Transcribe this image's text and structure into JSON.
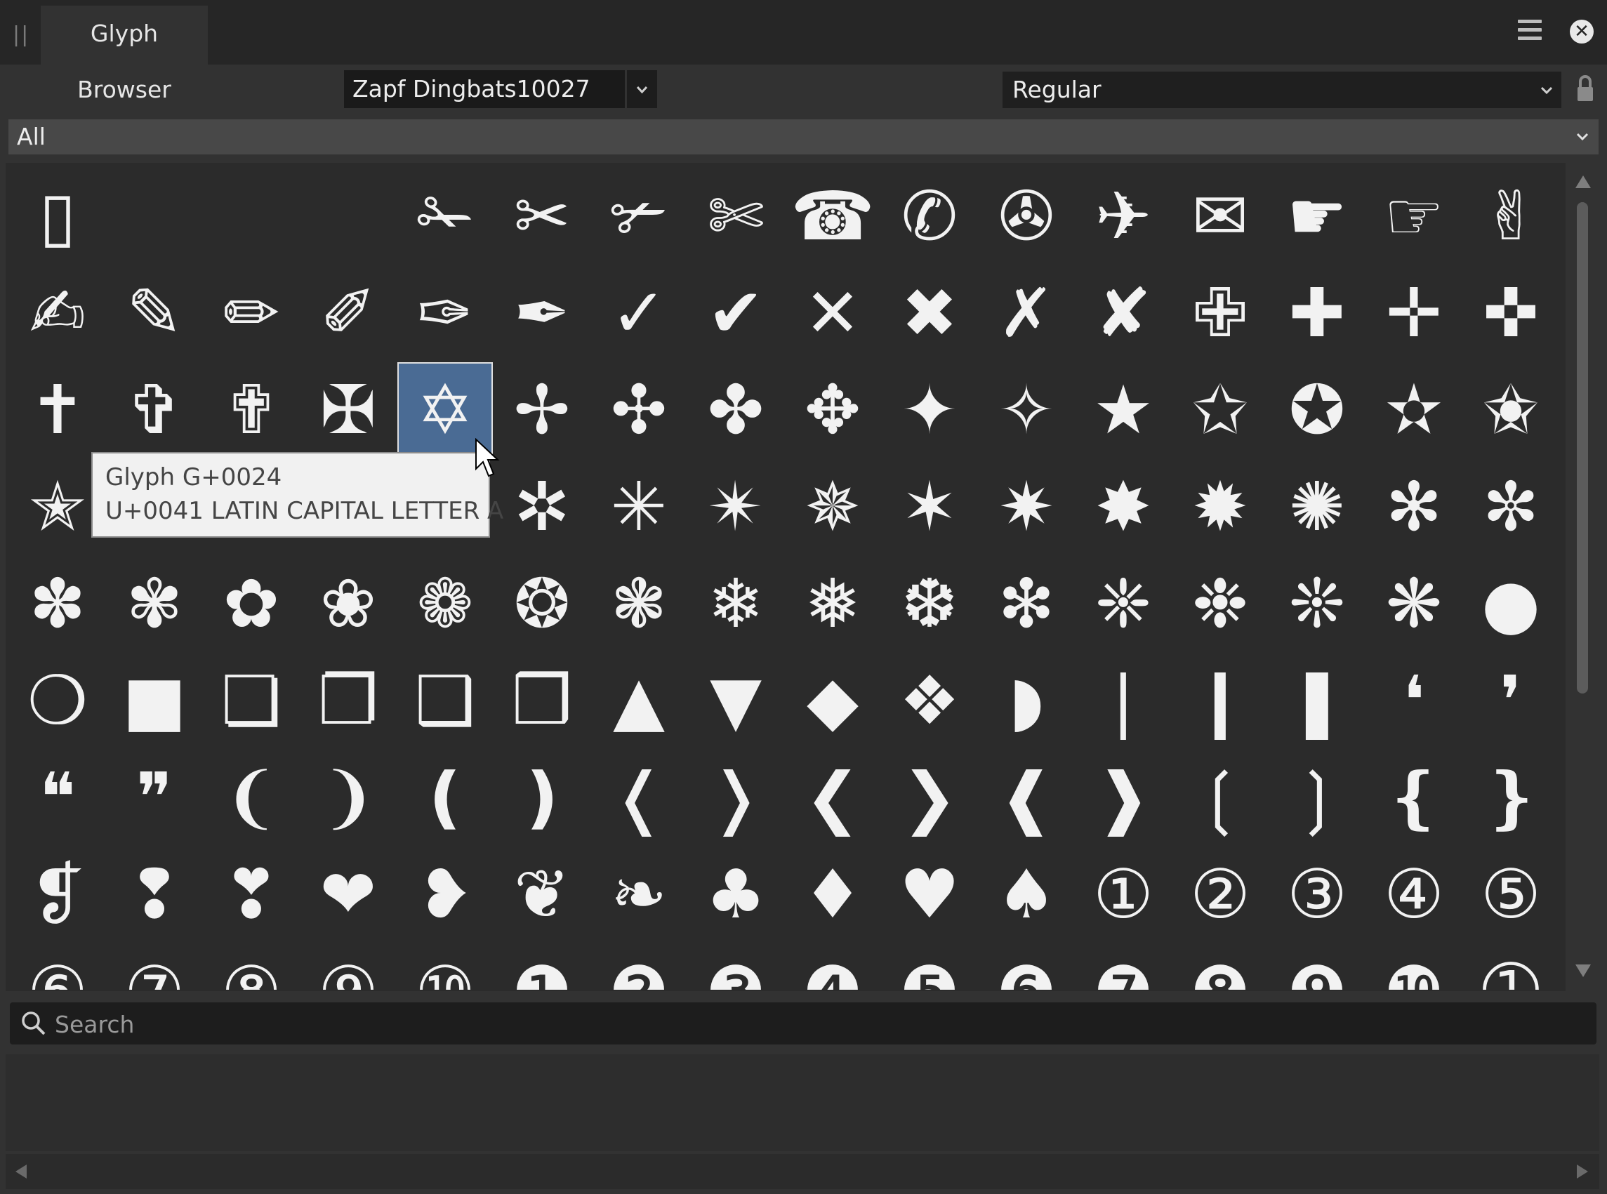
{
  "window": {
    "tab_label": "Glyph Browser",
    "menu_icon": "hamburger-menu-icon",
    "close_icon": "close-icon"
  },
  "toolbar": {
    "font_family": "Zapf Dingbats10027",
    "font_style": "Regular",
    "category": "All",
    "lock_icon": "lock-icon"
  },
  "grid": {
    "selected_index": 36,
    "cells": [
      "▯",
      "",
      "",
      "",
      "✁",
      "✂",
      "✃",
      "✄",
      "☎",
      "✆",
      "✇",
      "✈",
      "✉",
      "☛",
      "☞",
      "✌",
      "✍",
      "✎",
      "✏",
      "✐",
      "✑",
      "✒",
      "✓",
      "✔",
      "✕",
      "✖",
      "✗",
      "✘",
      "✙",
      "✚",
      "✛",
      "✜",
      "✝",
      "✞",
      "✟",
      "✠",
      "✡",
      "✢",
      "✣",
      "✤",
      "✥",
      "✦",
      "✧",
      "★",
      "✩",
      "✪",
      "✫",
      "✬",
      "✭",
      "✮",
      "✯",
      "✰",
      "✱",
      "✲",
      "✳",
      "✴",
      "✵",
      "✶",
      "✷",
      "✸",
      "✹",
      "✺",
      "✻",
      "✼",
      "✽",
      "✾",
      "✿",
      "❀",
      "❁",
      "❂",
      "❃",
      "❄",
      "❅",
      "❆",
      "❇",
      "❈",
      "❉",
      "❊",
      "❋",
      "●",
      "❍",
      "■",
      "❏",
      "❐",
      "❑",
      "❒",
      "▲",
      "▼",
      "◆",
      "❖",
      "◗",
      "❘",
      "❙",
      "❚",
      "❛",
      "❜",
      "❝",
      "❞",
      "❨",
      "❩",
      "❪",
      "❫",
      "❬",
      "❭",
      "❮",
      "❯",
      "❰",
      "❱",
      "❲",
      "❳",
      "❴",
      "❵",
      "❡",
      "❢",
      "❣",
      "❤",
      "❥",
      "❦",
      "❧",
      "♣",
      "♦",
      "♥",
      "♠",
      "①",
      "②",
      "③",
      "④",
      "⑤",
      "⑥",
      "⑦",
      "⑧",
      "⑨",
      "⑩",
      "❶",
      "❷",
      "❸",
      "❹",
      "❺",
      "❻",
      "❼",
      "❽",
      "❾",
      "❿",
      "➀"
    ]
  },
  "tooltip": {
    "line1": "Glyph G+0024",
    "line2": "U+0041 LATIN CAPITAL LETTER A"
  },
  "search": {
    "placeholder": "Search",
    "value": "",
    "icon": "search-icon"
  },
  "colors": {
    "selection": "#4a6b94",
    "background": "#323232",
    "grid_background": "#2b2b2b"
  }
}
